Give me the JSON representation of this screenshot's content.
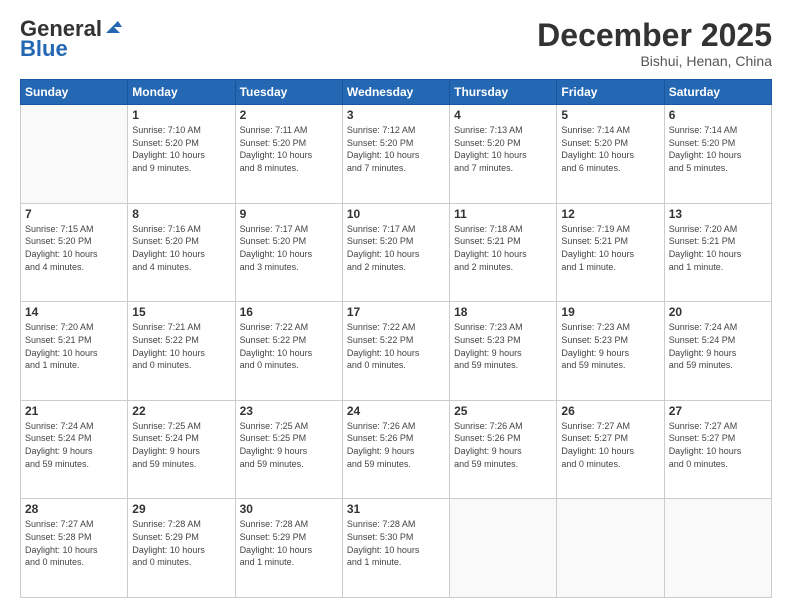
{
  "header": {
    "logo_general": "General",
    "logo_blue": "Blue",
    "month_title": "December 2025",
    "location": "Bishui, Henan, China"
  },
  "days_of_week": [
    "Sunday",
    "Monday",
    "Tuesday",
    "Wednesday",
    "Thursday",
    "Friday",
    "Saturday"
  ],
  "weeks": [
    [
      {
        "day": "",
        "info": ""
      },
      {
        "day": "1",
        "info": "Sunrise: 7:10 AM\nSunset: 5:20 PM\nDaylight: 10 hours\nand 9 minutes."
      },
      {
        "day": "2",
        "info": "Sunrise: 7:11 AM\nSunset: 5:20 PM\nDaylight: 10 hours\nand 8 minutes."
      },
      {
        "day": "3",
        "info": "Sunrise: 7:12 AM\nSunset: 5:20 PM\nDaylight: 10 hours\nand 7 minutes."
      },
      {
        "day": "4",
        "info": "Sunrise: 7:13 AM\nSunset: 5:20 PM\nDaylight: 10 hours\nand 7 minutes."
      },
      {
        "day": "5",
        "info": "Sunrise: 7:14 AM\nSunset: 5:20 PM\nDaylight: 10 hours\nand 6 minutes."
      },
      {
        "day": "6",
        "info": "Sunrise: 7:14 AM\nSunset: 5:20 PM\nDaylight: 10 hours\nand 5 minutes."
      }
    ],
    [
      {
        "day": "7",
        "info": "Sunrise: 7:15 AM\nSunset: 5:20 PM\nDaylight: 10 hours\nand 4 minutes."
      },
      {
        "day": "8",
        "info": "Sunrise: 7:16 AM\nSunset: 5:20 PM\nDaylight: 10 hours\nand 4 minutes."
      },
      {
        "day": "9",
        "info": "Sunrise: 7:17 AM\nSunset: 5:20 PM\nDaylight: 10 hours\nand 3 minutes."
      },
      {
        "day": "10",
        "info": "Sunrise: 7:17 AM\nSunset: 5:20 PM\nDaylight: 10 hours\nand 2 minutes."
      },
      {
        "day": "11",
        "info": "Sunrise: 7:18 AM\nSunset: 5:21 PM\nDaylight: 10 hours\nand 2 minutes."
      },
      {
        "day": "12",
        "info": "Sunrise: 7:19 AM\nSunset: 5:21 PM\nDaylight: 10 hours\nand 1 minute."
      },
      {
        "day": "13",
        "info": "Sunrise: 7:20 AM\nSunset: 5:21 PM\nDaylight: 10 hours\nand 1 minute."
      }
    ],
    [
      {
        "day": "14",
        "info": "Sunrise: 7:20 AM\nSunset: 5:21 PM\nDaylight: 10 hours\nand 1 minute."
      },
      {
        "day": "15",
        "info": "Sunrise: 7:21 AM\nSunset: 5:22 PM\nDaylight: 10 hours\nand 0 minutes."
      },
      {
        "day": "16",
        "info": "Sunrise: 7:22 AM\nSunset: 5:22 PM\nDaylight: 10 hours\nand 0 minutes."
      },
      {
        "day": "17",
        "info": "Sunrise: 7:22 AM\nSunset: 5:22 PM\nDaylight: 10 hours\nand 0 minutes."
      },
      {
        "day": "18",
        "info": "Sunrise: 7:23 AM\nSunset: 5:23 PM\nDaylight: 9 hours\nand 59 minutes."
      },
      {
        "day": "19",
        "info": "Sunrise: 7:23 AM\nSunset: 5:23 PM\nDaylight: 9 hours\nand 59 minutes."
      },
      {
        "day": "20",
        "info": "Sunrise: 7:24 AM\nSunset: 5:24 PM\nDaylight: 9 hours\nand 59 minutes."
      }
    ],
    [
      {
        "day": "21",
        "info": "Sunrise: 7:24 AM\nSunset: 5:24 PM\nDaylight: 9 hours\nand 59 minutes."
      },
      {
        "day": "22",
        "info": "Sunrise: 7:25 AM\nSunset: 5:24 PM\nDaylight: 9 hours\nand 59 minutes."
      },
      {
        "day": "23",
        "info": "Sunrise: 7:25 AM\nSunset: 5:25 PM\nDaylight: 9 hours\nand 59 minutes."
      },
      {
        "day": "24",
        "info": "Sunrise: 7:26 AM\nSunset: 5:26 PM\nDaylight: 9 hours\nand 59 minutes."
      },
      {
        "day": "25",
        "info": "Sunrise: 7:26 AM\nSunset: 5:26 PM\nDaylight: 9 hours\nand 59 minutes."
      },
      {
        "day": "26",
        "info": "Sunrise: 7:27 AM\nSunset: 5:27 PM\nDaylight: 10 hours\nand 0 minutes."
      },
      {
        "day": "27",
        "info": "Sunrise: 7:27 AM\nSunset: 5:27 PM\nDaylight: 10 hours\nand 0 minutes."
      }
    ],
    [
      {
        "day": "28",
        "info": "Sunrise: 7:27 AM\nSunset: 5:28 PM\nDaylight: 10 hours\nand 0 minutes."
      },
      {
        "day": "29",
        "info": "Sunrise: 7:28 AM\nSunset: 5:29 PM\nDaylight: 10 hours\nand 0 minutes."
      },
      {
        "day": "30",
        "info": "Sunrise: 7:28 AM\nSunset: 5:29 PM\nDaylight: 10 hours\nand 1 minute."
      },
      {
        "day": "31",
        "info": "Sunrise: 7:28 AM\nSunset: 5:30 PM\nDaylight: 10 hours\nand 1 minute."
      },
      {
        "day": "",
        "info": ""
      },
      {
        "day": "",
        "info": ""
      },
      {
        "day": "",
        "info": ""
      }
    ]
  ]
}
